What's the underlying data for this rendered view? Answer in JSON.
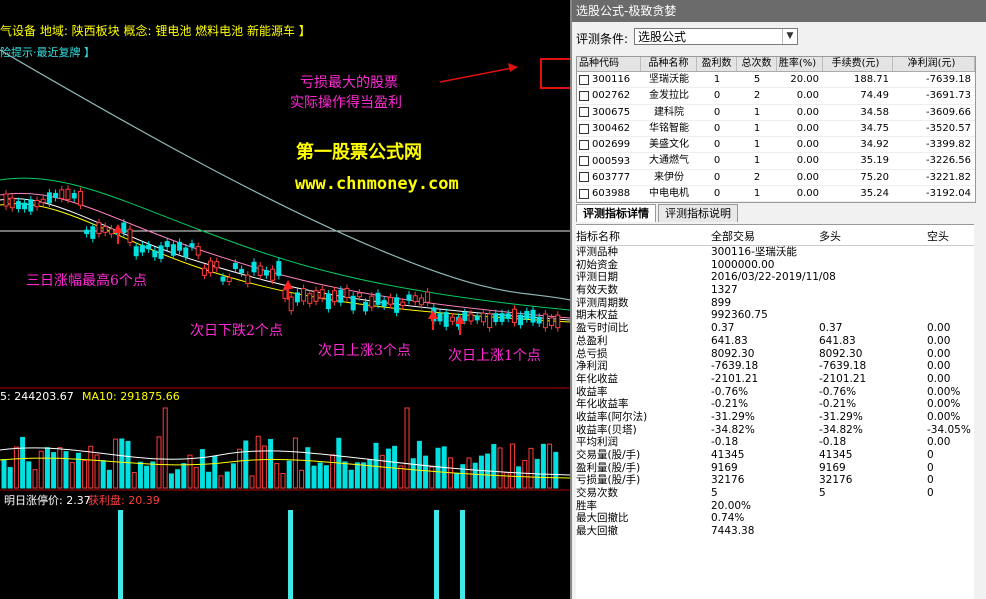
{
  "chart_panel": {
    "info_line": "气设备  地域: 陕西板块  概念: 锂电池 燃料电池 新能源车 】",
    "hint_line": "险提示·最近复牌 】",
    "watermark_site": "第一股票公式网",
    "watermark_url": "www.chnmoney.com",
    "callout_loss": "亏损最大的股票",
    "callout_profit": "实际操作得当盈利",
    "ann_three_day": "三日涨幅最高6个点",
    "ann_down2": "次日下跌2个点",
    "ann_up3": "次日上涨3个点",
    "ann_up1": "次日上涨1个点",
    "vol_label": "5: 244203.67",
    "ma10_label": "MA10: 291875.66",
    "limit_label": "明日涨停价: 2.37",
    "profit_label": "获利盘: 20.39",
    "colors": {
      "up": "#ff3c3c",
      "down": "#00e0e0",
      "annotation": "#ff2ad4",
      "ma_white": "#ffffff",
      "ma_yellow": "#ffff00",
      "ma_pink": "#ff80c0",
      "ma_green": "#00d060",
      "signal": "#40e8e8"
    }
  },
  "screener": {
    "title": "选股公式-极致贪婪",
    "condition_label": "评测条件:",
    "condition_value": "选股公式",
    "columns": [
      "品种代码",
      "品种名称",
      "盈利数",
      "总次数",
      "胜率(%)",
      "手续费(元)",
      "净利润(元)"
    ],
    "rows": [
      [
        "300116",
        "坚瑞沃能",
        "1",
        "5",
        "20.00",
        "188.71",
        "-7639.18"
      ],
      [
        "002762",
        "金发拉比",
        "0",
        "2",
        "0.00",
        "74.49",
        "-3691.73"
      ],
      [
        "300675",
        "建科院",
        "0",
        "1",
        "0.00",
        "34.58",
        "-3609.66"
      ],
      [
        "300462",
        "华铭智能",
        "0",
        "1",
        "0.00",
        "34.75",
        "-3520.57"
      ],
      [
        "002699",
        "美盛文化",
        "0",
        "1",
        "0.00",
        "34.92",
        "-3399.82"
      ],
      [
        "000593",
        "大通燃气",
        "0",
        "1",
        "0.00",
        "35.19",
        "-3226.56"
      ],
      [
        "603777",
        "来伊份",
        "0",
        "2",
        "0.00",
        "75.20",
        "-3221.82"
      ],
      [
        "603988",
        "中电电机",
        "0",
        "1",
        "0.00",
        "35.24",
        "-3192.04"
      ]
    ],
    "tabs": [
      "评测指标详情",
      "评测指标说明"
    ],
    "detail_header": [
      "指标名称",
      "全部交易",
      "多头",
      "空头"
    ],
    "details": [
      [
        "评测品种",
        "300116-坚瑞沃能",
        "",
        ""
      ],
      [
        "初始资金",
        "1000000.00",
        "",
        ""
      ],
      [
        "评测日期",
        "2016/03/22-2019/11/08",
        "",
        ""
      ],
      [
        "有效天数",
        "1327",
        "",
        ""
      ],
      [
        "评测周期数",
        "899",
        "",
        ""
      ],
      [
        "期末权益",
        "992360.75",
        "",
        ""
      ],
      [
        "盈亏时间比",
        "0.37",
        "0.37",
        "0.00"
      ],
      [
        "总盈利",
        "641.83",
        "641.83",
        "0.00"
      ],
      [
        "总亏损",
        "8092.30",
        "8092.30",
        "0.00"
      ],
      [
        "净利润",
        "-7639.18",
        "-7639.18",
        "0.00"
      ],
      [
        "年化收益",
        "-2101.21",
        "-2101.21",
        "0.00"
      ],
      [
        "收益率",
        "-0.76%",
        "-0.76%",
        "0.00%"
      ],
      [
        "年化收益率",
        "-0.21%",
        "-0.21%",
        "0.00%"
      ],
      [
        "收益率(阿尔法)",
        "-31.29%",
        "-31.29%",
        "0.00%"
      ],
      [
        "收益率(贝塔)",
        "-34.82%",
        "-34.82%",
        "-34.05%"
      ],
      [
        "平均利润",
        "-0.18",
        "-0.18",
        "0.00"
      ],
      [
        "交易量(股/手)",
        "41345",
        "41345",
        "0"
      ],
      [
        "盈利量(股/手)",
        "9169",
        "9169",
        "0"
      ],
      [
        "亏损量(股/手)",
        "32176",
        "32176",
        "0"
      ],
      [
        "交易次数",
        "5",
        "5",
        "0"
      ],
      [
        "胜率",
        "20.00%",
        "",
        ""
      ],
      [
        "最大回撤比",
        "0.74%",
        "",
        ""
      ],
      [
        "最大回撤",
        "7443.38",
        "",
        ""
      ]
    ]
  }
}
